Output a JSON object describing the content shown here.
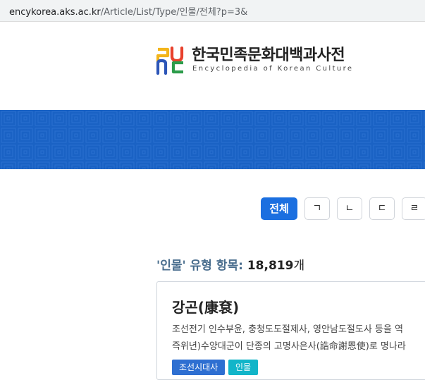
{
  "browser": {
    "url_host": "encykorea.aks.ac.kr",
    "url_path": "/Article/List/Type/인물/전체?p=3&"
  },
  "header": {
    "title": "한국민족문화대백과사전",
    "subtitle": "Encyclopedia of Korean Culture"
  },
  "filter_tabs": [
    "전체",
    "ㄱ",
    "ㄴ",
    "ㄷ",
    "ㄹ"
  ],
  "active_tab": "전체",
  "result_summary": {
    "type_name": "'인물'",
    "label": "유형 항목:",
    "count": "18,819",
    "unit": "개"
  },
  "results": [
    {
      "title": "강곤(康袞)",
      "description_line1": "조선전기 인수부윤, 충청도도절제사, 영안남도절도사 등을 역",
      "description_line2": "즉위년)수양대군이 단종의 고명사은사(誥命謝恩使)로 명나라",
      "tags": [
        "조선시대사",
        "인물"
      ]
    }
  ],
  "colors": {
    "brand_blue": "#1a62c4",
    "active_tab": "#1b6fe0",
    "tag_era": "#2e6fd1",
    "tag_type": "#12b5c9",
    "logo_yellow": "#f3b51b",
    "logo_red": "#e8412c",
    "logo_blue": "#2d56b8",
    "logo_green": "#2d9c4b"
  }
}
